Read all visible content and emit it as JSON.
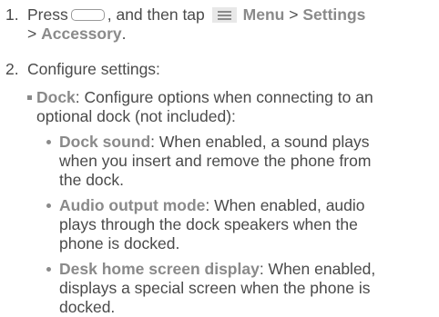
{
  "step1": {
    "number": "1.",
    "press": "Press",
    "then_tap": ", and then tap",
    "menu": "Menu",
    "gt1": ">",
    "settings": "Settings",
    "gt2": ">",
    "accessory": "Accessory",
    "period": "."
  },
  "step2": {
    "number": "2.",
    "text": "Configure settings:"
  },
  "dock": {
    "label": "Dock",
    "text_line1": ": Configure options when connecting to an",
    "text_line2": "optional dock (not included):"
  },
  "items": [
    {
      "label": "Dock sound",
      "line1": ": When enabled, a sound plays",
      "line2": "when you insert and remove the phone from",
      "line3": "the dock."
    },
    {
      "label": "Audio output mode",
      "line1": ": When enabled, audio",
      "line2": "plays through the dock speakers when the",
      "line3": "phone is docked."
    },
    {
      "label": "Desk home screen display",
      "line1": ": When enabled,",
      "line2": "displays a special screen when the phone is",
      "line3": "docked."
    }
  ],
  "icons": {
    "home_key": "home-key-icon",
    "menu_key": "menu-icon"
  },
  "colors": {
    "text": "#4a4a4a",
    "bold": "#8a8a8a"
  }
}
